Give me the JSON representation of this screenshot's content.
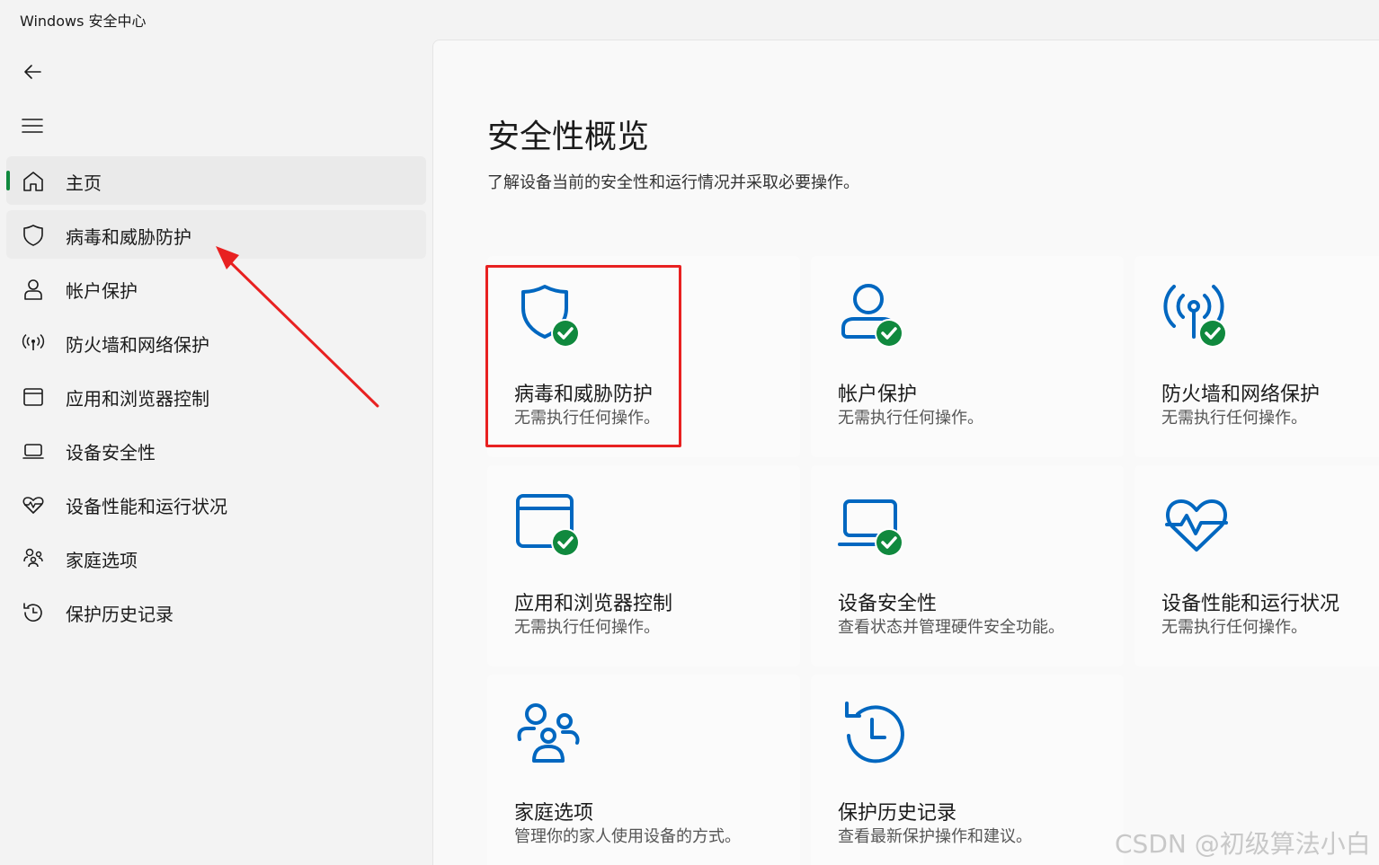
{
  "window": {
    "title": "Windows 安全中心"
  },
  "sidebar": {
    "items": [
      {
        "label": "主页",
        "icon": "home-icon",
        "state": "selected"
      },
      {
        "label": "病毒和威胁防护",
        "icon": "shield-icon",
        "state": "hover"
      },
      {
        "label": "帐户保护",
        "icon": "person-icon",
        "state": "normal"
      },
      {
        "label": "防火墙和网络保护",
        "icon": "antenna-icon",
        "state": "normal"
      },
      {
        "label": "应用和浏览器控制",
        "icon": "app-window-icon",
        "state": "normal"
      },
      {
        "label": "设备安全性",
        "icon": "laptop-icon",
        "state": "normal"
      },
      {
        "label": "设备性能和运行状况",
        "icon": "heart-pulse-icon",
        "state": "normal"
      },
      {
        "label": "家庭选项",
        "icon": "family-icon",
        "state": "normal"
      },
      {
        "label": "保护历史记录",
        "icon": "history-icon",
        "state": "normal"
      }
    ]
  },
  "main": {
    "title": "安全性概览",
    "subtitle": "了解设备当前的安全性和运行情况并采取必要操作。",
    "cards": [
      {
        "title": "病毒和威胁防护",
        "desc": "无需执行任何操作。",
        "icon": "shield-icon",
        "status": "ok"
      },
      {
        "title": "帐户保护",
        "desc": "无需执行任何操作。",
        "icon": "person-icon",
        "status": "ok"
      },
      {
        "title": "防火墙和网络保护",
        "desc": "无需执行任何操作。",
        "icon": "antenna-icon",
        "status": "ok"
      },
      {
        "title": "应用和浏览器控制",
        "desc": "无需执行任何操作。",
        "icon": "app-window-icon",
        "status": "ok"
      },
      {
        "title": "设备安全性",
        "desc": "查看状态并管理硬件安全功能。",
        "icon": "laptop-icon",
        "status": "ok"
      },
      {
        "title": "设备性能和运行状况",
        "desc": "无需执行任何操作。",
        "icon": "heart-pulse-icon",
        "status": "none"
      },
      {
        "title": "家庭选项",
        "desc": "管理你的家人使用设备的方式。",
        "icon": "family-icon",
        "status": "none"
      },
      {
        "title": "保护历史记录",
        "desc": "查看最新保护操作和建议。",
        "icon": "history-icon",
        "status": "none"
      }
    ]
  },
  "annotation": {
    "box_color": "#e82121",
    "arrow_color": "#e82121"
  },
  "watermark": "CSDN @初级算法小白",
  "colors": {
    "accent": "#0067c0",
    "ok": "#10893e",
    "selected_indicator": "#10893e"
  }
}
